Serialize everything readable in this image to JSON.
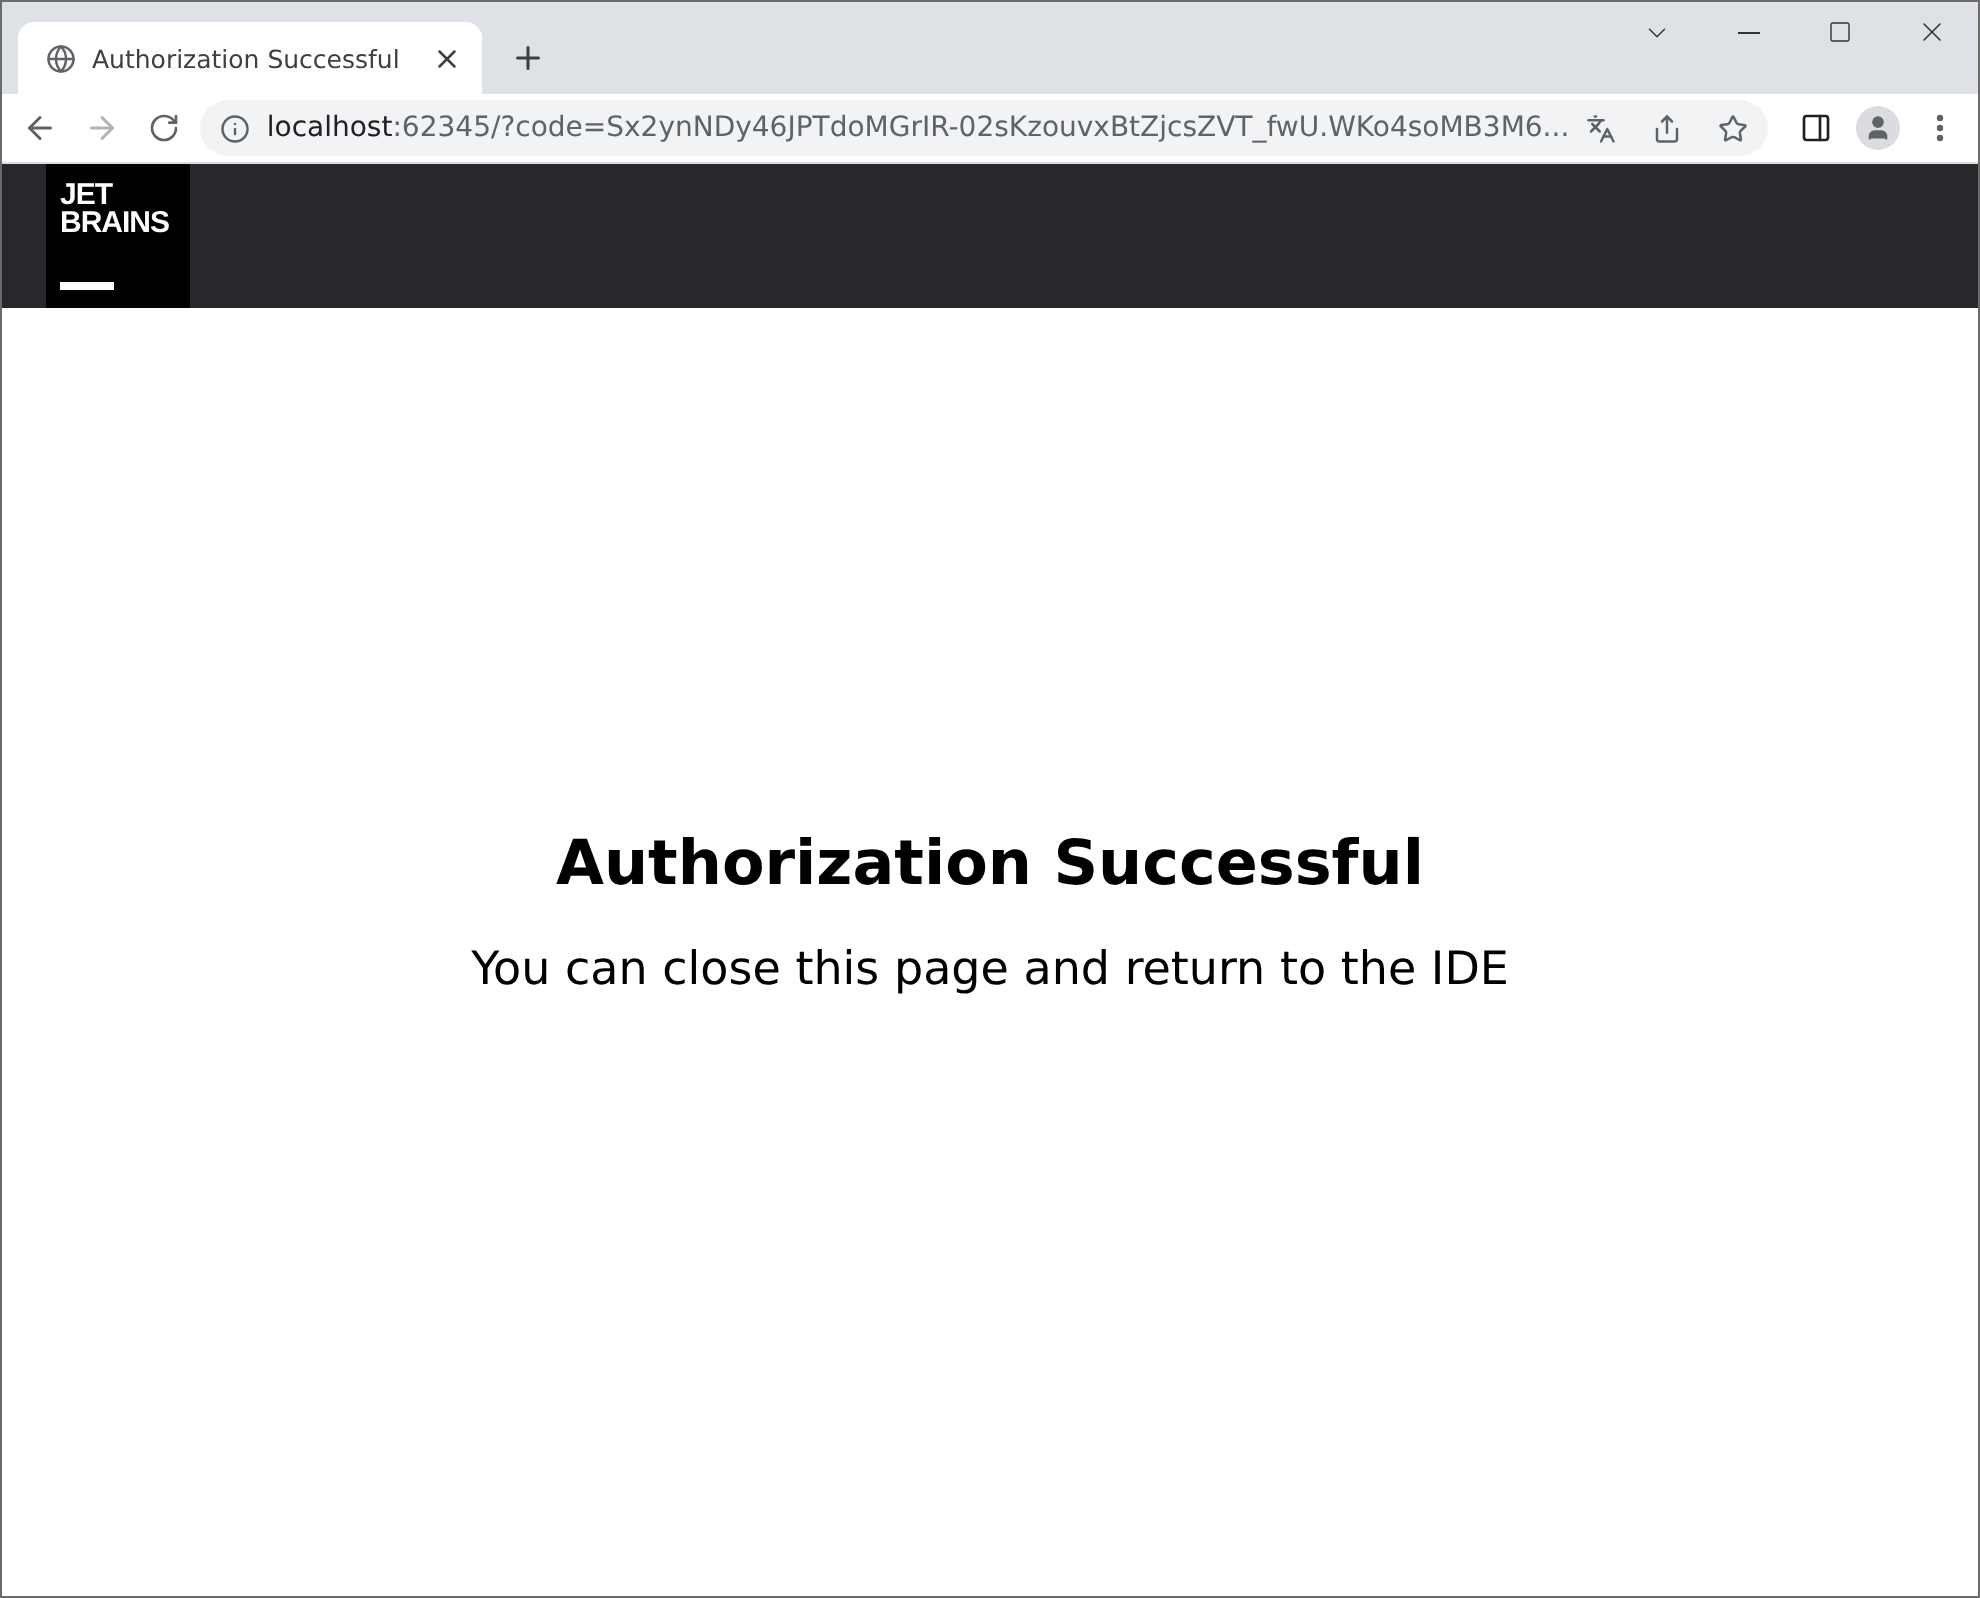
{
  "browser": {
    "tab": {
      "title": "Authorization Successful",
      "selected": true
    },
    "address": {
      "host": "localhost",
      "rest": ":62345/?code=Sx2ynNDy46JPTdoMGrIR-02sKzouvxBtZjcsZVT_fwU.WKo4soMB3M6..."
    }
  },
  "header": {
    "logo_lines": [
      "JET",
      "BRAINS"
    ]
  },
  "content": {
    "title": "Authorization Successful",
    "message": "You can close this page and return to the IDE"
  }
}
